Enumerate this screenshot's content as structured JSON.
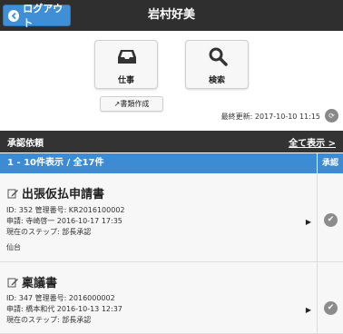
{
  "header": {
    "logout_label": "ログアウト",
    "user_name": "岩村好美"
  },
  "main": {
    "work_label": "仕事",
    "search_label": "検索",
    "create_doc_label": "書類作成",
    "last_updated": "最終更新: 2017-10-10 11:15"
  },
  "approval": {
    "section_title": "承認依頼",
    "show_all_label": "全て表示 >",
    "count_text": "1 - 10件表示 / 全17件",
    "approve_col": "承認"
  },
  "items": [
    {
      "title": "出張仮払申請書",
      "line1": "ID: 352 管理番号: KR2016100002",
      "line2": "申請: 寺崎啓一 2016-10-17 17:35",
      "line3": "現在のステップ: 部長承認",
      "line4": "仙台"
    },
    {
      "title": "稟議書",
      "line1": "ID: 347 管理番号: 2016000002",
      "line2": "申請: 橋本和代 2016-10-13 12:37",
      "line3": "現在のステップ: 部長承認"
    }
  ],
  "colors": {
    "header_bg": "#2f2f2f",
    "accent_blue": "#3d8bd3",
    "section_bg": "#333333"
  }
}
